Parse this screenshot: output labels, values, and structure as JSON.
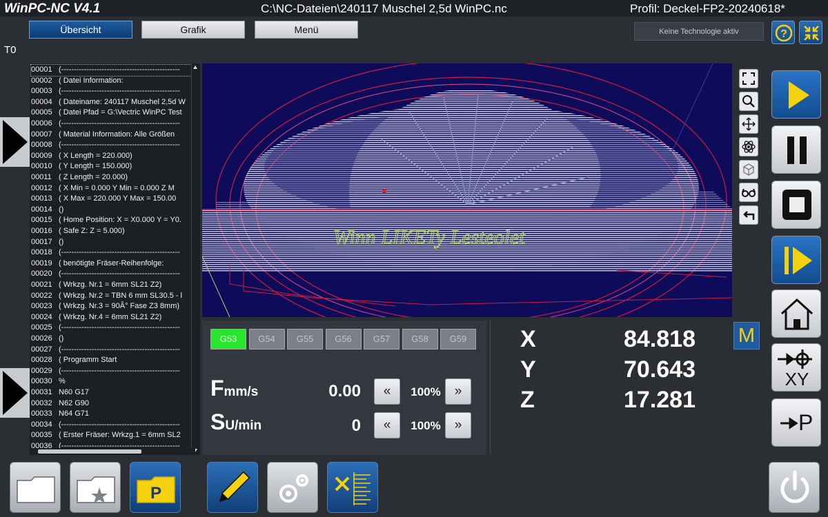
{
  "titlebar": {
    "app": "WinPC-NC  V4.1",
    "file": "C:\\NC-Dateien\\240117 Muschel 2,5d WinPC.nc",
    "profile": "Profil: Deckel-FP2-20240618*"
  },
  "nav": {
    "overview": "Übersicht",
    "graphics": "Grafik",
    "menu": "Menü",
    "technology": "Keine Technologie aktiv"
  },
  "tool_label": "T0",
  "code_lines": [
    {
      "num": "00001",
      "text": "(-----------------------------------------------"
    },
    {
      "num": "00002",
      "text": "( Datei Information:"
    },
    {
      "num": "00003",
      "text": "(-----------------------------------------------"
    },
    {
      "num": "00004",
      "text": "( Dateiname: 240117 Muschel 2,5d W"
    },
    {
      "num": "00005",
      "text": "( Datei Pfad = G:\\Vectric WinPC Test"
    },
    {
      "num": "00006",
      "text": "(-----------------------------------------------"
    },
    {
      "num": "00007",
      "text": "( Material Information:     Alle Größen"
    },
    {
      "num": "00008",
      "text": "(-----------------------------------------------"
    },
    {
      "num": "00009",
      "text": "(  X Length = 220.000)"
    },
    {
      "num": "00010",
      "text": "(  Y Length = 150.000)"
    },
    {
      "num": "00011",
      "text": "(  Z Length = 20.000)"
    },
    {
      "num": "00012",
      "text": "(  X Min = 0.000   Y Min = 0.000  Z M"
    },
    {
      "num": "00013",
      "text": "(  X Max = 220.000   Y Max = 150.00"
    },
    {
      "num": "00014",
      "text": "()"
    },
    {
      "num": "00015",
      "text": "( Home Position: X = X0.000 Y = Y0."
    },
    {
      "num": "00016",
      "text": "( Safe Z: Z = 5.000)"
    },
    {
      "num": "00017",
      "text": "()"
    },
    {
      "num": "00018",
      "text": "(-----------------------------------------------"
    },
    {
      "num": "00019",
      "text": "( benötigte Fräser-Reihenfolge:"
    },
    {
      "num": "00020",
      "text": "(-----------------------------------------------"
    },
    {
      "num": "00021",
      "text": "( Wrkzg. Nr.1 = 6mm SL21 Z2)"
    },
    {
      "num": "00022",
      "text": "( Wrkzg. Nr.2 = TBN 6 mm SL30.5 - l"
    },
    {
      "num": "00023",
      "text": "( Wrkzg. Nr.3 = 90Â° Fase Z3 8mm)"
    },
    {
      "num": "00024",
      "text": "( Wrkzg. Nr.4 = 6mm SL21 Z2)"
    },
    {
      "num": "00025",
      "text": "(-----------------------------------------------"
    },
    {
      "num": "00026",
      "text": "()"
    },
    {
      "num": "00027",
      "text": "(-----------------------------------------------"
    },
    {
      "num": "00028",
      "text": "( Programm Start"
    },
    {
      "num": "00029",
      "text": "(-----------------------------------------------"
    },
    {
      "num": "00030",
      "text": "%"
    },
    {
      "num": "00031",
      "text": "N60 G17"
    },
    {
      "num": "00032",
      "text": "N62 G90"
    },
    {
      "num": "00033",
      "text": "N64 G71"
    },
    {
      "num": "00034",
      "text": "(-----------------------------------------------"
    },
    {
      "num": "00035",
      "text": "( Erster Fräser:  Wrkzg.1 = 6mm SL2"
    },
    {
      "num": "00036",
      "text": "(-----------------------------------------------"
    }
  ],
  "offsets": [
    "G53",
    "G54",
    "G55",
    "G56",
    "G57",
    "G58",
    "G59"
  ],
  "active_offset": "G53",
  "feed": {
    "letter": "F",
    "unit": "mm/s",
    "value": "0.00",
    "override": "100%"
  },
  "spindle": {
    "letter": "S",
    "unit": "U/min",
    "value": "0",
    "override": "100%"
  },
  "coords": [
    {
      "axis": "X",
      "value": "84.818"
    },
    {
      "axis": "Y",
      "value": "70.643"
    },
    {
      "axis": "Z",
      "value": "17.281"
    }
  ],
  "mode_badge": "M",
  "ref_button": {
    "label": "XY"
  },
  "park_button": {
    "label": "P"
  },
  "colors": {
    "accent_blue": "#1f5b9e",
    "active_green": "#27e62b",
    "yellow": "#f5d20f"
  }
}
